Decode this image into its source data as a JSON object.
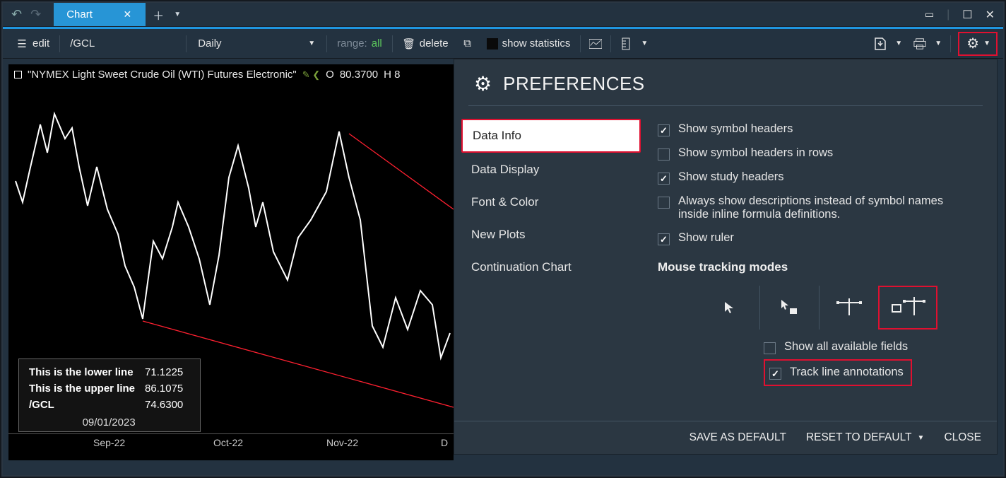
{
  "tab": {
    "label": "Chart"
  },
  "toolbar": {
    "edit": "edit",
    "symbol": "/GCL",
    "period": "Daily",
    "range_label": "range:",
    "range_value": "all",
    "delete": "delete",
    "stats": "show statistics"
  },
  "chart": {
    "headerTitle": "\"NYMEX Light Sweet Crude Oil (WTI) Futures Electronic\"",
    "ohlc_prefix": "O",
    "ohlc_open": "80.3700",
    "ohlc_h": "H 8",
    "info": {
      "row1_label": "This is the lower line",
      "row1_val": "71.1225",
      "row2_label": "This is the upper line",
      "row2_val": "86.1075",
      "row3_label": "/GCL",
      "row3_val": "74.6300",
      "date": "09/01/2023"
    },
    "axis": {
      "t1": "Sep-22",
      "t2": "Oct-22",
      "t3": "Nov-22",
      "t4": "D"
    }
  },
  "prefs": {
    "title": "PREFERENCES",
    "tabs": {
      "dataInfo": "Data Info",
      "dataDisplay": "Data Display",
      "fontColor": "Font & Color",
      "newPlots": "New Plots",
      "contChart": "Continuation Chart"
    },
    "opts": {
      "showSymbolHeaders": "Show symbol headers",
      "showSymbolHeadersRows": "Show symbol headers in rows",
      "showStudyHeaders": "Show study headers",
      "alwaysDesc": "Always show descriptions instead of symbol names inside inline formula definitions.",
      "showRuler": "Show ruler",
      "mouseModes": "Mouse tracking modes",
      "showAllFields": "Show all available fields",
      "trackLineAnn": "Track line annotations"
    },
    "footer": {
      "saveDefault": "SAVE AS DEFAULT",
      "resetDefault": "RESET TO DEFAULT",
      "close": "CLOSE"
    }
  }
}
